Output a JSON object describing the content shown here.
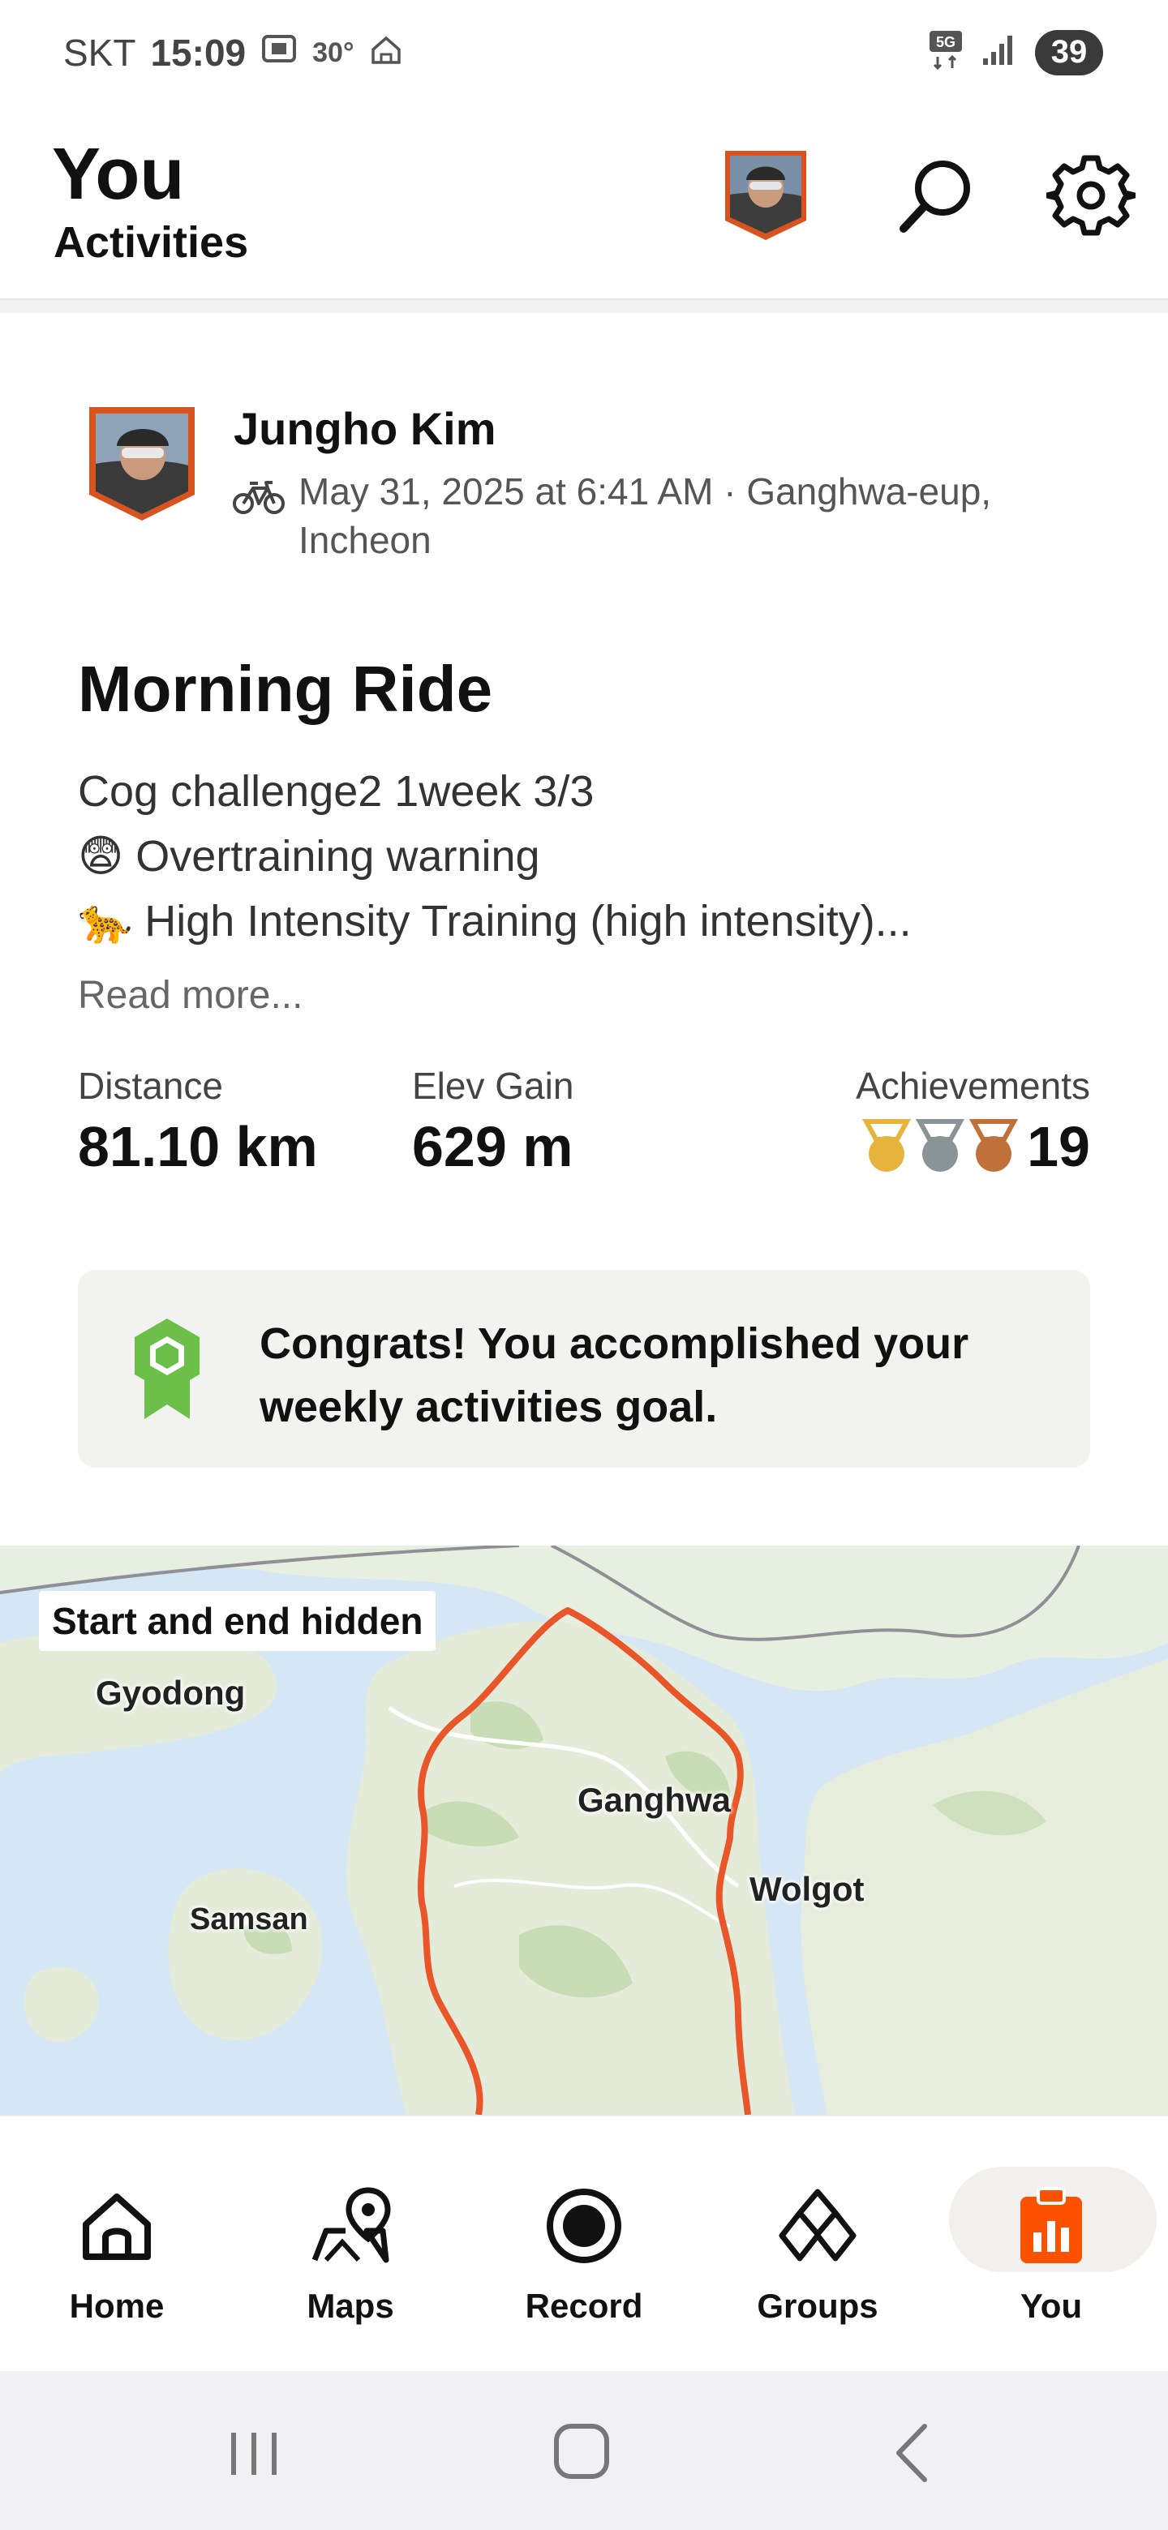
{
  "status_bar": {
    "carrier": "SKT",
    "time": "15:09",
    "temperature": "30°",
    "network": "5G",
    "battery": "39"
  },
  "header": {
    "title": "You",
    "subtitle": "Activities",
    "avatar_icon": "user-avatar",
    "search_icon": "search-icon",
    "settings_icon": "gear-icon"
  },
  "activity": {
    "athlete_name": "Jungho Kim",
    "sport_icon": "bike-icon",
    "meta_line1": "May 31, 2025 at 6:41 AM · Ganghwa-eup,",
    "meta_line2": "Incheon",
    "title": "Morning Ride",
    "description": [
      "Cog challenge2  1week 3/3",
      "😨 Overtraining warning",
      "🐆 High Intensity Training (high intensity)..."
    ],
    "read_more": "Read more...",
    "stats": {
      "distance_label": "Distance",
      "distance_value": "81.10 km",
      "elev_label": "Elev Gain",
      "elev_value": "629 m",
      "achievements_label": "Achievements",
      "achievements_count": "19",
      "medal_colors": [
        "#e6b43c",
        "#8a9496",
        "#c0703a"
      ]
    },
    "congrats": {
      "icon": "award-ribbon-icon",
      "text": "Congrats! You accomplished your weekly activities goal."
    }
  },
  "map": {
    "badge": "Start and end hidden",
    "places": {
      "gyodong": "Gyodong",
      "ganghwa": "Ganghwa",
      "wolgot": "Wolgot",
      "samsan": "Samsan"
    },
    "route_color": "#e8562a"
  },
  "bottom_nav": [
    {
      "label": "Home",
      "icon": "home-icon",
      "active": false
    },
    {
      "label": "Maps",
      "icon": "map-pin-icon",
      "active": false
    },
    {
      "label": "Record",
      "icon": "record-icon",
      "active": false
    },
    {
      "label": "Groups",
      "icon": "groups-icon",
      "active": false
    },
    {
      "label": "You",
      "icon": "clipboard-chart-icon",
      "active": true
    }
  ],
  "colors": {
    "brand": "#fc5200",
    "accent_green": "#6cc04a"
  }
}
